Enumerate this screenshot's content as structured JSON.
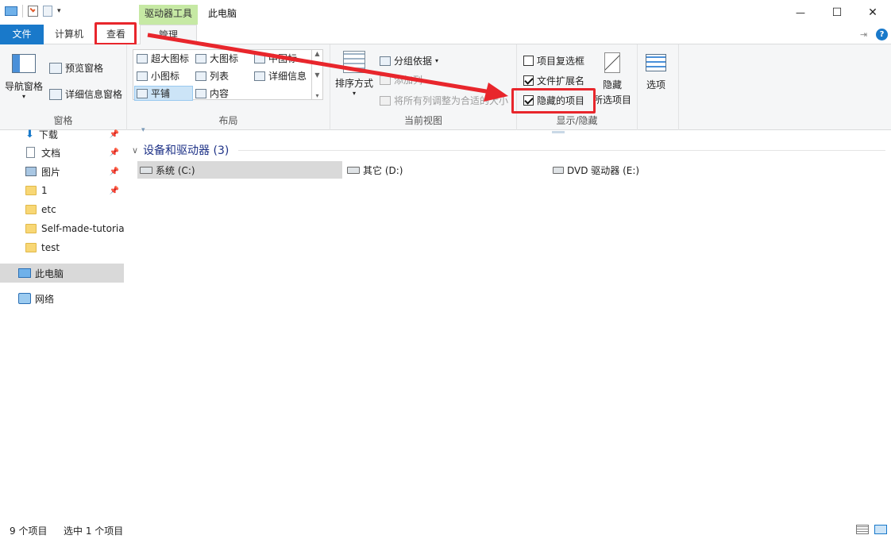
{
  "window": {
    "title": "此电脑",
    "context_tab": "驱动器工具",
    "controls": {
      "minimize": "—",
      "maximize": "☐",
      "close": "✕"
    }
  },
  "tabs": {
    "file": "文件",
    "computer": "计算机",
    "view": "查看",
    "manage": "管理"
  },
  "ribbon": {
    "pane_group": {
      "label": "窗格",
      "nav_pane": "导航窗格",
      "preview_pane": "预览窗格",
      "details_pane": "详细信息窗格"
    },
    "layout_group": {
      "label": "布局",
      "items": [
        "超大图标",
        "大图标",
        "中图标",
        "小图标",
        "列表",
        "详细信息",
        "平铺",
        "内容"
      ],
      "selected": "平铺"
    },
    "current_view_group": {
      "label": "当前视图",
      "sort_by": "排序方式",
      "group_by": "分组依据",
      "add_columns": "添加列",
      "size_all_columns": "将所有列调整为合适的大小"
    },
    "show_hide_group": {
      "label": "显示/隐藏",
      "item_checkboxes": {
        "label": "项目复选框",
        "checked": false
      },
      "file_extensions": {
        "label": "文件扩展名",
        "checked": true
      },
      "hidden_items": {
        "label": "隐藏的项目",
        "checked": true
      },
      "hide_selected_line1": "隐藏",
      "hide_selected_line2": "所选项目"
    },
    "options": "选项"
  },
  "nav": {
    "items": [
      {
        "label": "下载",
        "pinned": true
      },
      {
        "label": "文档",
        "pinned": true
      },
      {
        "label": "图片",
        "pinned": true
      },
      {
        "label": "1",
        "pinned": true
      },
      {
        "label": "etc",
        "pinned": false
      },
      {
        "label": "Self-made-tutoria",
        "pinned": false
      },
      {
        "label": "test",
        "pinned": false
      },
      {
        "label": "此电脑",
        "pinned": false
      },
      {
        "label": "网络",
        "pinned": false
      }
    ],
    "pin_glyph": "📌"
  },
  "content": {
    "group_title": "设备和驱动器 (3)",
    "drives": [
      {
        "label": "系统 (C:)",
        "selected": true
      },
      {
        "label": "其它 (D:)",
        "selected": false
      },
      {
        "label": "DVD 驱动器 (E:)",
        "selected": false
      }
    ]
  },
  "status": {
    "items_count": "9 个项目",
    "selected_count": "选中 1 个项目"
  },
  "colors": {
    "accent": "#1979ca",
    "context_tab": "#c6e9a4",
    "highlight": "#e8262c",
    "group_title": "#1e3287"
  }
}
